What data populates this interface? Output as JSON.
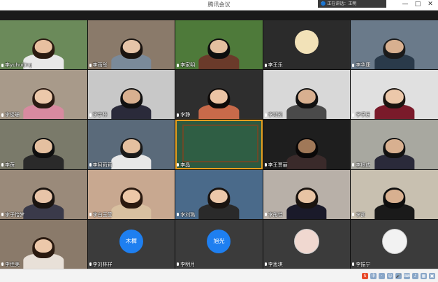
{
  "window": {
    "title": "腾讯会议",
    "recording_badge": "🔵 正在讲话：王明",
    "minimize_glyph": "—",
    "maximize_glyph": "□",
    "close_glyph": "✕"
  },
  "participants": [
    {
      "label": "李yuhuijing",
      "bg": "#6b8a5a",
      "shirt": "#e8e8e8",
      "hair": "#2a1a10",
      "skin": "#e8c0a0"
    },
    {
      "label": "李雨彤",
      "bg": "#8a7a6a",
      "shirt": "#7a8a9a",
      "hair": "#1a1410",
      "skin": "#e6c4a8"
    },
    {
      "label": "李家明",
      "bg": "#4e7a3a",
      "shirt": "#6a3a2a",
      "hair": "#0e0e0e",
      "skin": "#e4c0a0"
    },
    {
      "label": "李王乐",
      "bg": "#2b2b2b",
      "shirt": "#2b2b2b",
      "hair": "#2b2b2b",
      "skin": "#2b2b2b"
    },
    {
      "label": "李华康",
      "bg": "#6a7a8a",
      "shirt": "#2a3a4a",
      "hair": "#1a1a1a",
      "skin": "#d8b090"
    },
    {
      "label": "李俊珊",
      "bg": "#a89a8a",
      "shirt": "#d88aa0",
      "hair": "#2a1a12",
      "skin": "#ecc8aa"
    },
    {
      "label": "李宇林",
      "bg": "#c8c8c8",
      "shirt": "#2a2a3a",
      "hair": "#111",
      "skin": "#d8b090"
    },
    {
      "label": "李静",
      "bg": "#2e2e2e",
      "shirt": "#c86a4a",
      "hair": "#0e0a08",
      "skin": "#ecc4a4"
    },
    {
      "label": "李延凯",
      "bg": "#d8d8d8",
      "shirt": "#4a4a4a",
      "hair": "#111",
      "skin": "#d8b090"
    },
    {
      "label": "李孚辰",
      "bg": "#e0e0e0",
      "shirt": "#7a1a2a",
      "hair": "#1a1410",
      "skin": "#ecc8aa"
    },
    {
      "label": "李蓓",
      "bg": "#7a7a6a",
      "shirt": "#2a2a2a",
      "hair": "#0e0e0e",
      "skin": "#e4c0a0"
    },
    {
      "label": "李阿莉莉",
      "bg": "#5a6a7a",
      "shirt": "#e8e8e8",
      "hair": "#1a1a1a",
      "skin": "#e4c0a0"
    },
    {
      "label": "李晶",
      "bg": "#2e5a40",
      "shirt": "#2e5a40",
      "hair": "#2e5a40",
      "skin": "#2e5a40"
    },
    {
      "label": "李王贾丽",
      "bg": "#1e1e1e",
      "shirt": "#3a2a2a",
      "hair": "#0a0808",
      "skin": "#a07858"
    },
    {
      "label": "李杨成",
      "bg": "#a8a8a0",
      "shirt": "#2a2a3a",
      "hair": "#111",
      "skin": "#d8b090"
    },
    {
      "label": "李子怡梦",
      "bg": "#9a8a7a",
      "shirt": "#3a3a4a",
      "hair": "#1a1410",
      "skin": "#e8c4a8"
    },
    {
      "label": "李白玉莹",
      "bg": "#c8a890",
      "shirt": "#d8c0a0",
      "hair": "#2a1a10",
      "skin": "#ecc8a8"
    },
    {
      "label": "李刘璐",
      "bg": "#4a6a8a",
      "shirt": "#2a2a2a",
      "hair": "#1a1410",
      "skin": "#ecc8aa"
    },
    {
      "label": "李彤佳",
      "bg": "#b8b0a8",
      "shirt": "#1a1a2a",
      "hair": "#1a1410",
      "skin": "#e8c4a4"
    },
    {
      "label": "李凯",
      "bg": "#c8c0b0",
      "shirt": "#1a1a1a",
      "hair": "#0e0e0e",
      "skin": "#d8b090"
    },
    {
      "label": "李佳美",
      "bg": "#8a7a6a",
      "shirt": "#e8e0d8",
      "hair": "#2a1a10",
      "skin": "#ecc8aa"
    },
    {
      "label": "李刘林祥",
      "bg": "#3b3b3b",
      "avatar": "木樨"
    },
    {
      "label": "李明月",
      "bg": "#3b3b3b",
      "avatar": "旭光"
    },
    {
      "label": "李思琪",
      "bg": "#3b3b3b",
      "photo": "#f0d8d0"
    },
    {
      "label": "李振宁",
      "bg": "#3b3b3b",
      "photo": "#f2f2f2"
    }
  ],
  "taskbar": {
    "tray_icons": [
      "S",
      "中",
      "·",
      "☺",
      "🎤",
      "⌨",
      "♪",
      "▦",
      "▣"
    ]
  }
}
